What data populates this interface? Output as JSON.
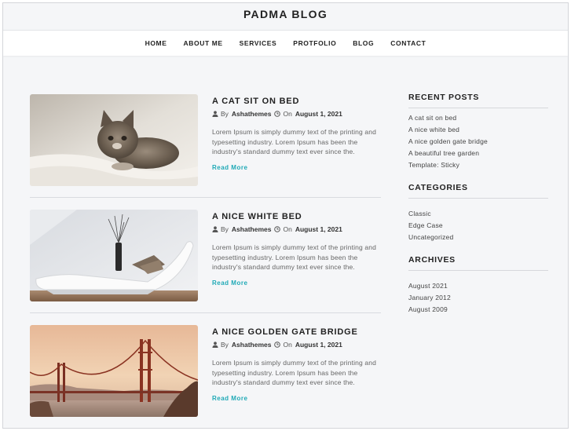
{
  "site": {
    "title": "PADMA BLOG"
  },
  "nav": {
    "items": [
      "HOME",
      "ABOUT ME",
      "SERVICES",
      "PROTFOLIO",
      "BLOG",
      "CONTACT"
    ]
  },
  "posts": [
    {
      "title": "A CAT SIT ON BED",
      "by_label": "By",
      "author": "Ashathemes",
      "on_label": "On",
      "date": "August 1, 2021",
      "excerpt": "Lorem Ipsum is simply dummy text of the printing and typesetting industry. Lorem Ipsum has been the industry's standard dummy text ever since the.",
      "read_more": "Read More",
      "image": "kitten-photo"
    },
    {
      "title": "A NICE WHITE BED",
      "by_label": "By",
      "author": "Ashathemes",
      "on_label": "On",
      "date": "August 1, 2021",
      "excerpt": "Lorem Ipsum is simply dummy text of the printing and typesetting industry. Lorem Ipsum has been the industry's standard dummy text ever since the.",
      "read_more": "Read More",
      "image": "white-lounge-chair-photo"
    },
    {
      "title": "A NICE GOLDEN GATE BRIDGE",
      "by_label": "By",
      "author": "Ashathemes",
      "on_label": "On",
      "date": "August 1, 2021",
      "excerpt": "Lorem Ipsum is simply dummy text of the printing and typesetting industry. Lorem Ipsum has been the industry's standard dummy text ever since the.",
      "read_more": "Read More",
      "image": "golden-gate-bridge-photo"
    }
  ],
  "sidebar": {
    "recent_posts": {
      "title": "RECENT POSTS",
      "items": [
        "A cat sit on bed",
        "A nice white bed",
        "A nice golden gate bridge",
        "A beautiful tree garden",
        "Template: Sticky"
      ]
    },
    "categories": {
      "title": "CATEGORIES",
      "items": [
        "Classic",
        "Edge Case",
        "Uncategorized"
      ]
    },
    "archives": {
      "title": "ARCHIVES",
      "items": [
        "August 2021",
        "January 2012",
        "August 2009"
      ]
    }
  },
  "colors": {
    "accent": "#1fa9b6",
    "background": "#f5f6f8",
    "text": "#222222"
  },
  "icons": {
    "author": "user-icon",
    "date": "clock-icon"
  }
}
